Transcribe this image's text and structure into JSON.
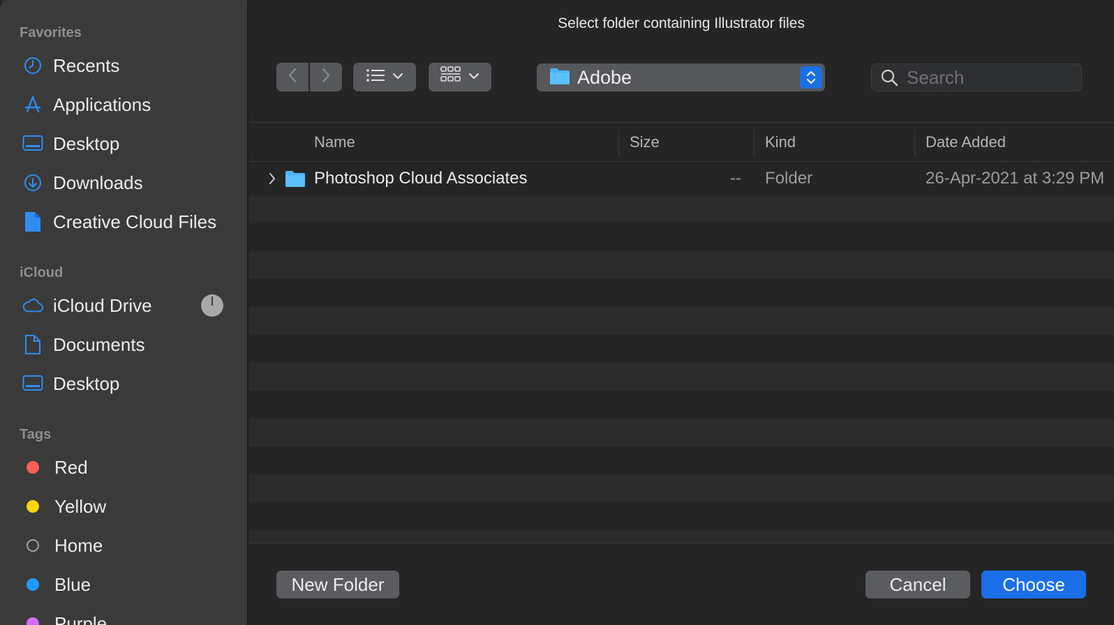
{
  "dialog": {
    "title": "Select folder containing Illustrator files"
  },
  "sidebar": {
    "favorites_title": "Favorites",
    "favorites": [
      {
        "label": "Recents",
        "icon": "clock-icon"
      },
      {
        "label": "Applications",
        "icon": "applications-icon"
      },
      {
        "label": "Desktop",
        "icon": "desktop-icon"
      },
      {
        "label": "Downloads",
        "icon": "download-icon"
      },
      {
        "label": "Creative Cloud Files",
        "icon": "document-icon"
      }
    ],
    "icloud_title": "iCloud",
    "icloud": [
      {
        "label": "iCloud Drive",
        "icon": "cloud-icon"
      },
      {
        "label": "Documents",
        "icon": "document-icon"
      },
      {
        "label": "Desktop",
        "icon": "desktop-icon"
      }
    ],
    "tags_title": "Tags",
    "tags": [
      {
        "label": "Red",
        "color": "#ff5f57"
      },
      {
        "label": "Yellow",
        "color": "#ffd60a"
      },
      {
        "label": "Home",
        "color": ""
      },
      {
        "label": "Blue",
        "color": "#1f9bff"
      },
      {
        "label": "Purple",
        "color": "#d86bff"
      }
    ],
    "accent_color": "#2f8cf0"
  },
  "toolbar": {
    "path_label": "Adobe",
    "search_placeholder": "Search"
  },
  "table": {
    "columns": [
      "Name",
      "Size",
      "Kind",
      "Date Added"
    ],
    "rows": [
      {
        "name": "Photoshop Cloud Associates",
        "size": "--",
        "kind": "Folder",
        "date": "26-Apr-2021 at 3:29 PM"
      }
    ]
  },
  "buttons": {
    "new_folder": "New Folder",
    "cancel": "Cancel",
    "choose": "Choose"
  }
}
